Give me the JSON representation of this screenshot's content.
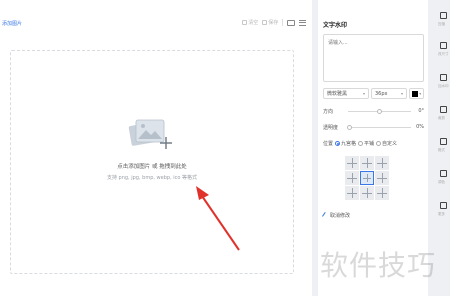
{
  "toolbar": {
    "add_image": "添加图片",
    "btn1": "清空",
    "btn2": "保存"
  },
  "upload": {
    "title": "点击添加图片 或 拖拽到此处",
    "formats": "支持 png, jpg, bmp, webp, ico 等格式"
  },
  "watermark_panel": {
    "title": "文字水印",
    "text_placeholder": "请输入...",
    "font": "微软雅黑",
    "size": "36px",
    "color": "#000000",
    "direction_label": "方向",
    "direction_value": "0°",
    "opacity_label": "透明度",
    "opacity_value": "0%",
    "position_label": "位置",
    "position_options": [
      "九宫格",
      "平铺",
      "自定义"
    ],
    "position_selected": "九宫格",
    "cancel_edit": "取消修改"
  },
  "side_tools": [
    "压缩",
    "改尺寸",
    "加水印",
    "裁剪",
    "格式",
    "调色",
    "更多"
  ],
  "site_watermark": "软件技巧",
  "colors": {
    "accent": "#3b78e7",
    "arrow": "#e0322b"
  }
}
